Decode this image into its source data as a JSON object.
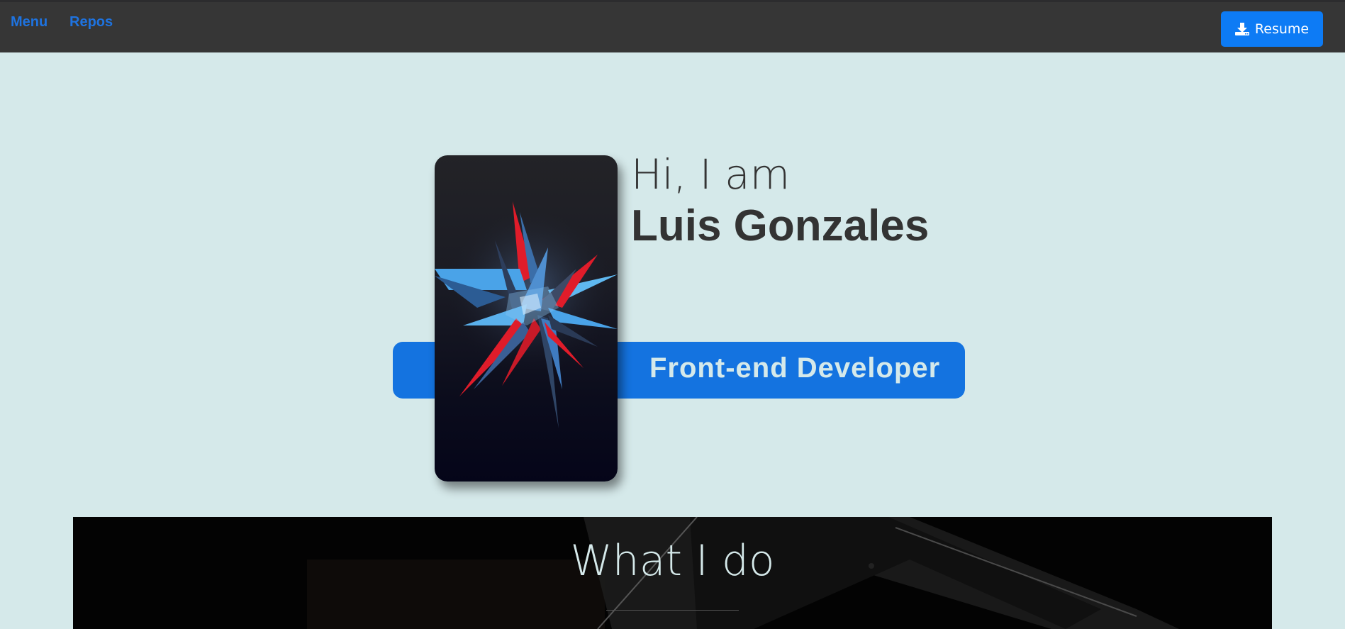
{
  "nav": {
    "links": [
      {
        "label": "Menu"
      },
      {
        "label": "Repos"
      }
    ],
    "resume_button": {
      "label": "Resume",
      "icon": "download-icon"
    }
  },
  "hero": {
    "greeting": "Hi, I am",
    "name": "Luis Gonzales",
    "role": "Front-end Developer",
    "phone_image": "abstract-crystal-wallpaper"
  },
  "section": {
    "title": "What I do"
  },
  "colors": {
    "navbar": "#363636",
    "accent": "#1473e0",
    "button": "#0d7bf5",
    "page_background": "#d5e9ea",
    "text_dark": "#333333"
  }
}
